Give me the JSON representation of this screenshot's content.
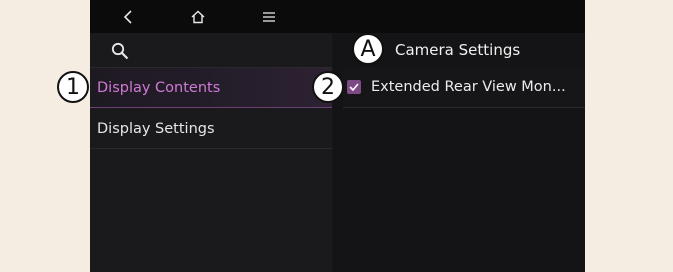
{
  "topbar": {
    "back_icon": "chevron-left-icon",
    "home_icon": "home-icon",
    "menu_icon": "hamburger-menu-icon"
  },
  "left_panel": {
    "search_icon": "search-icon",
    "items": [
      {
        "label": "Display Contents",
        "selected": true
      },
      {
        "label": "Display Settings",
        "selected": false
      }
    ]
  },
  "right_panel": {
    "title": "Camera Settings",
    "settings": [
      {
        "label": "Extended Rear View Mon...",
        "checked": true
      }
    ]
  },
  "callouts": {
    "a": "A",
    "one": "1",
    "two": "2"
  },
  "colors": {
    "accent": "#d07ad6",
    "checkbox": "#7d4a85",
    "background": "#f5ede2",
    "screen": "#161618"
  }
}
